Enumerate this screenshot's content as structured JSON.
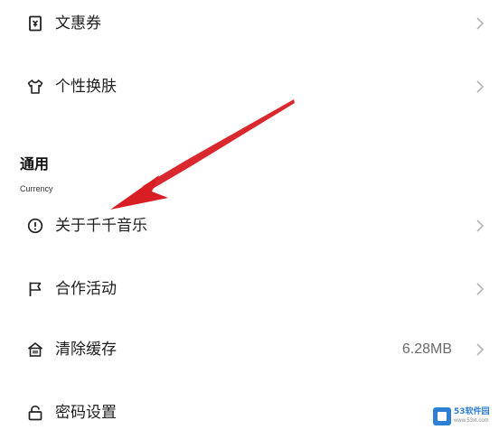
{
  "menu": {
    "items_top": [
      {
        "label": "文惠券",
        "icon": "coupon-icon"
      },
      {
        "label": "个性换肤",
        "icon": "shirt-icon"
      }
    ],
    "section": {
      "title": "通用",
      "subtitle": "Currency"
    },
    "items_general": [
      {
        "label": "关于千千音乐",
        "icon": "info-icon"
      },
      {
        "label": "合作活动",
        "icon": "flag-icon"
      },
      {
        "label": "清除缓存",
        "icon": "house-clean-icon",
        "value": "6.28MB"
      },
      {
        "label": "密码设置",
        "icon": "lock-icon"
      }
    ]
  },
  "colors": {
    "arrow": "#d81e23",
    "chevron": "#b5b5b5",
    "watermark": "#2d7fd3"
  },
  "watermark": {
    "name": "53软件园",
    "url": "www.53xt.com"
  }
}
